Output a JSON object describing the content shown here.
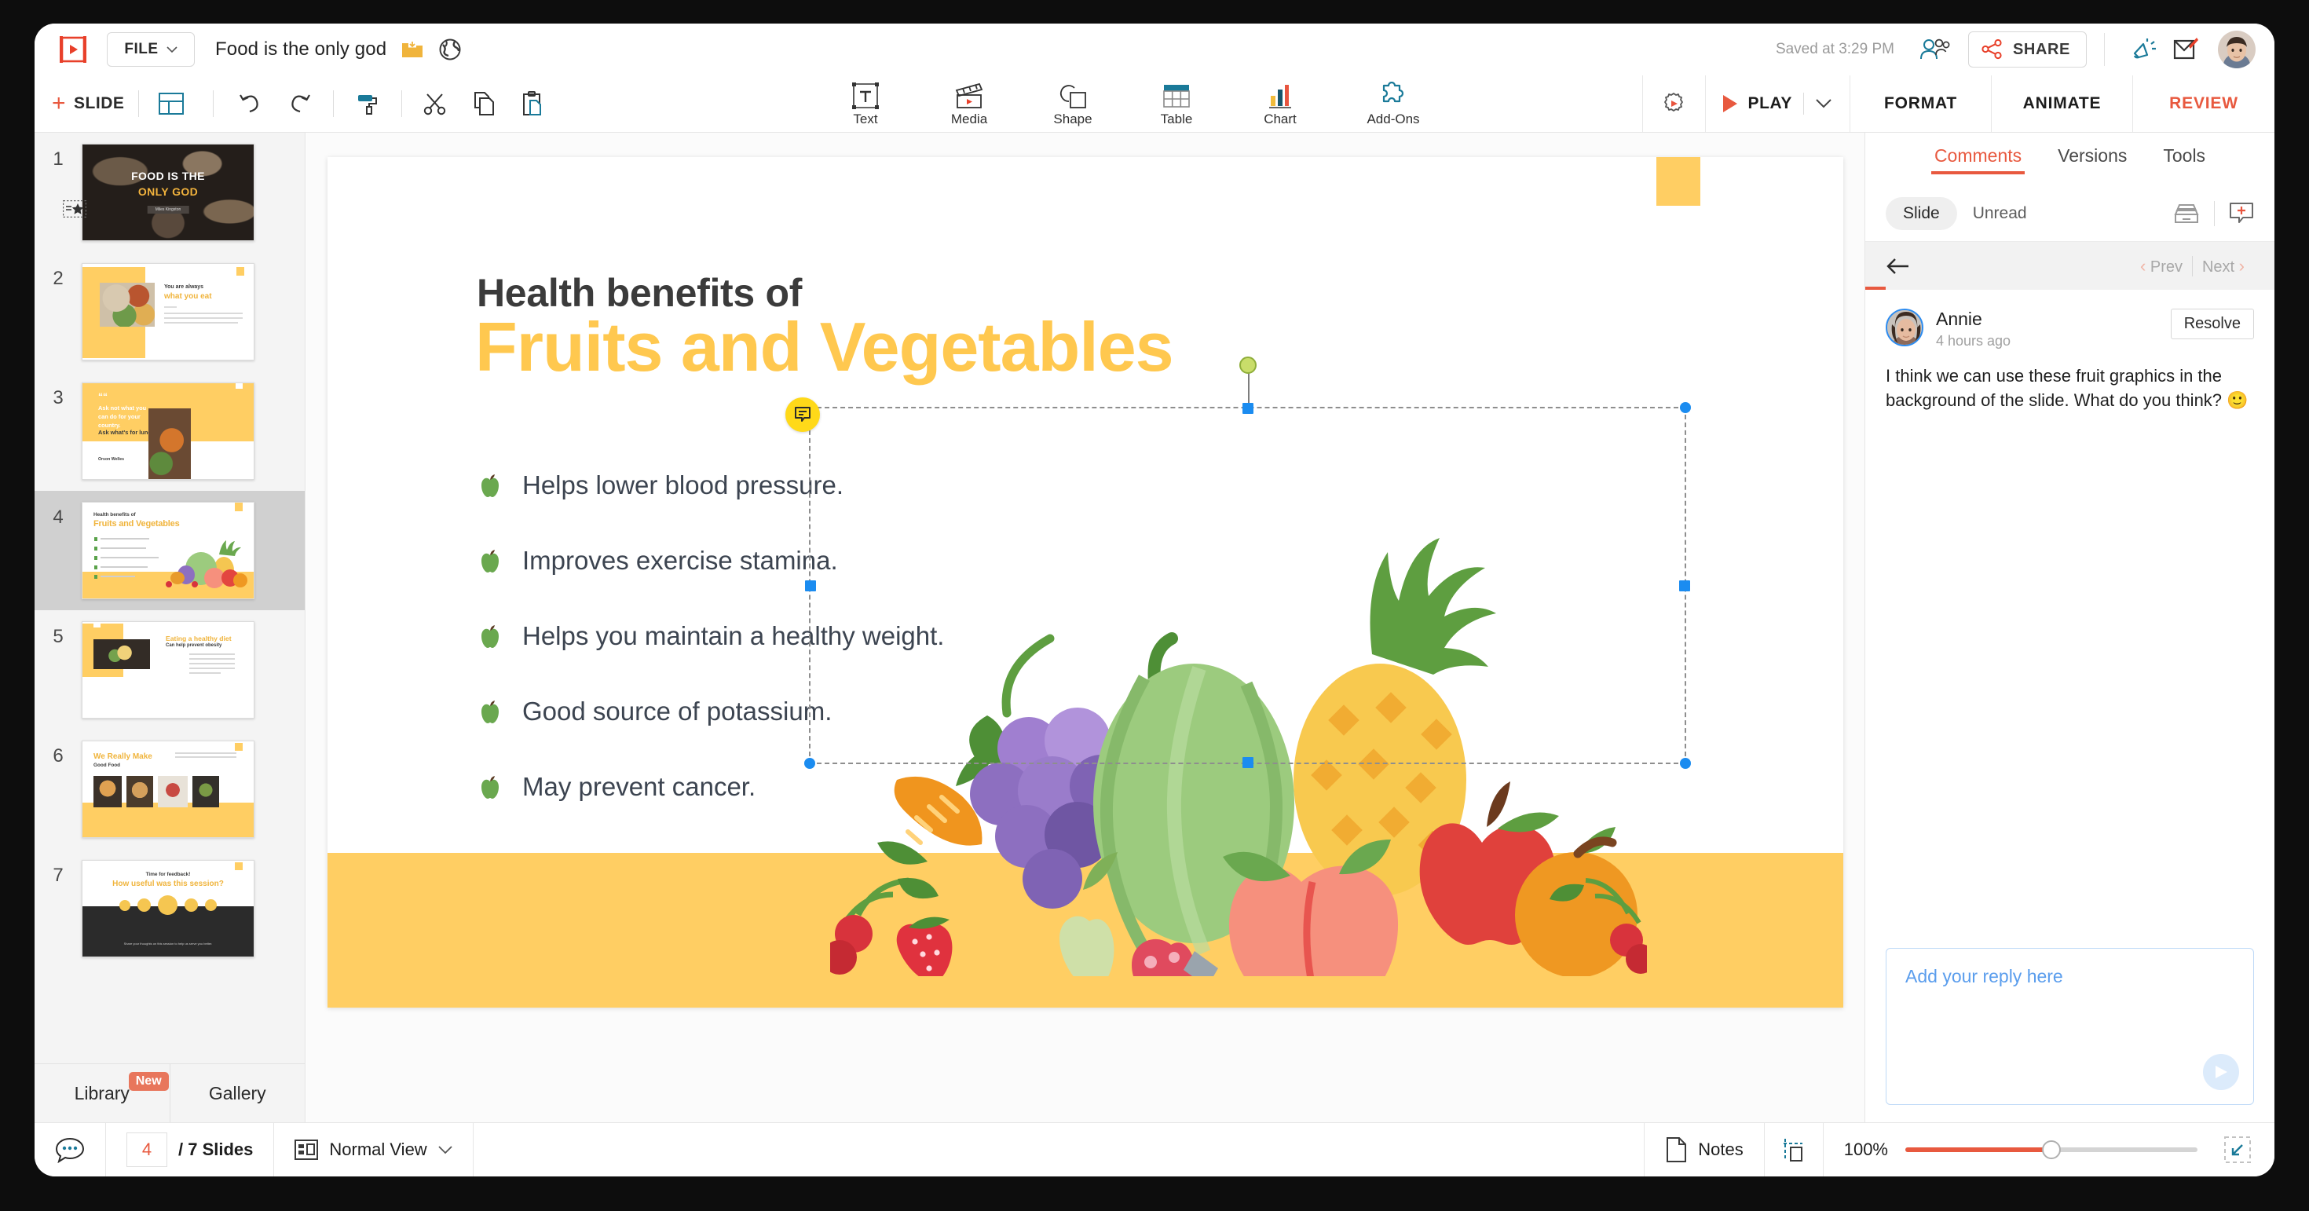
{
  "app": {
    "logo_icon": "presentation-logo-icon"
  },
  "topbar": {
    "file_label": "FILE",
    "doc_title": "Food is the only god",
    "save_icon": "folder-download-icon",
    "globe_icon": "globe-icon",
    "saved_status": "Saved at 3:29 PM",
    "collaborators_icon": "people-icon",
    "share_label": "SHARE",
    "share_icon": "share-nodes-icon",
    "announce_icon": "megaphone-icon",
    "feedback_icon": "edit-note-icon",
    "avatar_icon": "user-avatar"
  },
  "ribbon": {
    "add_slide_label": "SLIDE",
    "add_slide_plus": "+",
    "layout_icon": "slide-layout-icon",
    "undo_icon": "undo-icon",
    "redo_icon": "redo-icon",
    "paint_icon": "format-painter-icon",
    "cut_icon": "scissors-icon",
    "copy_icon": "copy-icon",
    "paste_icon": "paste-icon",
    "tools": [
      {
        "label": "Text",
        "icon": "text-box-icon"
      },
      {
        "label": "Media",
        "icon": "clapperboard-icon"
      },
      {
        "label": "Shape",
        "icon": "shapes-icon"
      },
      {
        "label": "Table",
        "icon": "table-icon"
      },
      {
        "label": "Chart",
        "icon": "bar-chart-icon"
      },
      {
        "label": "Add-Ons",
        "icon": "puzzle-piece-icon"
      }
    ],
    "settings_icon": "gear-play-icon",
    "play_label": "PLAY",
    "play_caret_icon": "chevron-down-icon",
    "tabs": [
      {
        "label": "FORMAT",
        "active": false
      },
      {
        "label": "ANIMATE",
        "active": false
      },
      {
        "label": "REVIEW",
        "active": true
      }
    ]
  },
  "slide_panel": {
    "slides": [
      {
        "num": "1",
        "kind": "title-dark",
        "line1": "FOOD IS THE",
        "line2": "ONLY GOD",
        "author": "Miles Kingston"
      },
      {
        "num": "2",
        "kind": "image-left",
        "line1": "You are always",
        "line2": "what you eat"
      },
      {
        "num": "3",
        "kind": "quote",
        "line1": "Ask not what you can do for your country.",
        "line2": "Ask what's for lunch.",
        "author": "Orson Welles"
      },
      {
        "num": "4",
        "kind": "current",
        "line1": "Health benefits of",
        "line2": "Fruits and Vegetables",
        "selected": true
      },
      {
        "num": "5",
        "kind": "diet",
        "line1": "Eating a healthy diet",
        "line2": "Can help prevent obesity"
      },
      {
        "num": "6",
        "kind": "gallery",
        "line1": "We Really Make",
        "line2": "Good Food"
      },
      {
        "num": "7",
        "kind": "feedback",
        "line1": "Time for feedback!",
        "line2": "How useful was this session?"
      }
    ],
    "tabs": [
      {
        "label": "Library",
        "badge": "New"
      },
      {
        "label": "Gallery",
        "badge": ""
      }
    ]
  },
  "slide": {
    "heading_small": "Health benefits of",
    "heading_large": "Fruits and Vegetables",
    "bullets": [
      "Helps lower blood pressure.",
      "Improves exercise stamina.",
      "Helps you maintain a healthy weight.",
      "Good source of potassium.",
      "May prevent cancer."
    ],
    "selected_object": "fruits-illustration",
    "comment_pin_icon": "comment-pin-icon",
    "rotate_handle_icon": "rotate-handle-icon"
  },
  "comments_panel": {
    "tabs": [
      {
        "label": "Comments",
        "active": true
      },
      {
        "label": "Versions",
        "active": false
      },
      {
        "label": "Tools",
        "active": false
      }
    ],
    "filters": [
      {
        "label": "Slide",
        "active": true
      },
      {
        "label": "Unread",
        "active": false
      }
    ],
    "archive_icon": "archive-tray-icon",
    "new_comment_icon": "add-comment-icon",
    "back_icon": "arrow-left-icon",
    "prev_label": "Prev",
    "next_label": "Next",
    "thread": {
      "author": "Annie",
      "timestamp": "4 hours ago",
      "resolve_label": "Resolve",
      "body": "I think we can use these fruit graphics in the background of the slide. What do you think? 🙂"
    },
    "reply_placeholder": "Add your reply here",
    "send_icon": "send-icon"
  },
  "bottombar": {
    "comments_icon": "comment-dots-icon",
    "slide_number": "4",
    "slide_total": "/ 7 Slides",
    "view_icon": "normal-view-icon",
    "view_label": "Normal View",
    "view_caret_icon": "chevron-down-icon",
    "notes_icon": "notes-page-icon",
    "notes_label": "Notes",
    "guides_icon": "guides-icon",
    "zoom_level": "100%",
    "fit_icon": "fit-to-screen-icon"
  },
  "colors": {
    "accent_red": "#e8593f",
    "brand_yellow": "#ffce63",
    "slide_title_yellow": "#ffc84f",
    "selection_blue": "#1b8cf0",
    "teal": "#1a7a99"
  }
}
